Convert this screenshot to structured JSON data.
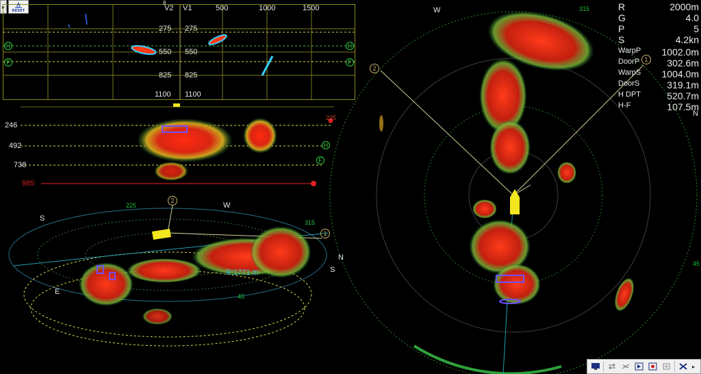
{
  "toolbar": {
    "reset_label": "RESET"
  },
  "echogram": {
    "col_v2": "V2",
    "col_v1": "V1",
    "ranges": [
      "500",
      "1000",
      "1500"
    ],
    "depths_left": [
      "275",
      "550",
      "825",
      "1100"
    ],
    "depths_right": [
      "275",
      "550",
      "825",
      "1100"
    ],
    "top_mark": "8",
    "h_marker": "H",
    "f_marker": "F"
  },
  "side_view": {
    "depths": [
      "246",
      "492",
      "738"
    ],
    "red_depth": "985",
    "bearing_label": "225",
    "h_marker": "H",
    "f_marker": "F"
  },
  "perspective": {
    "labels": {
      "s_left": "S",
      "w": "W",
      "n": "N",
      "s_right": "S",
      "e": "E"
    },
    "bearing_225": "225",
    "bearing_315": "315",
    "bearing_45": "45",
    "marker_1": "1",
    "marker_2": "2",
    "range_label": "R:1771 m"
  },
  "polar": {
    "w_label": "W",
    "n_label": "N",
    "bearing_315": "315",
    "bearing_45": "45",
    "marker_1": "1",
    "marker_2": "2"
  },
  "info": {
    "rows": [
      {
        "label": "R",
        "value": "2000m"
      },
      {
        "label": "G",
        "value": "4.0"
      },
      {
        "label": "P",
        "value": "5"
      },
      {
        "label": "S",
        "value": "4.2kn"
      }
    ],
    "net": [
      {
        "label": "WarpP",
        "value": "1002.0m"
      },
      {
        "label": "DoorP",
        "value": "302.6m"
      },
      {
        "label": "WarpS",
        "value": "1004.0m"
      },
      {
        "label": "DoorS",
        "value": "319.1m"
      },
      {
        "label": "H DPT",
        "value": "520.7m"
      },
      {
        "label": "H-F",
        "value": "107.5m"
      }
    ]
  },
  "colors": {
    "echo_red": "#e8281c",
    "grid_olive": "#8a8a1e",
    "green": "#22c33a",
    "yellow": "#f2e61e"
  }
}
